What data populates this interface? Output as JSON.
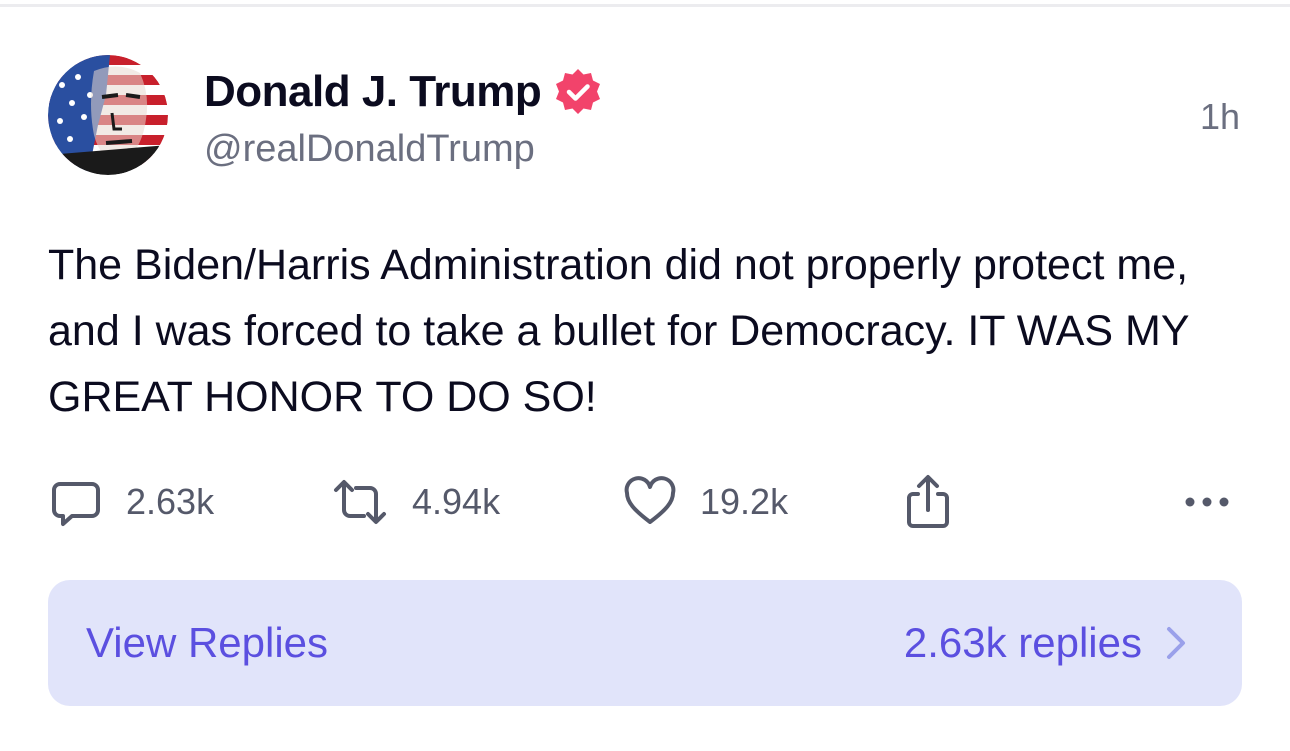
{
  "author": {
    "display_name": "Donald J. Trump",
    "handle": "@realDonaldTrump",
    "verified_icon": "verified-badge-icon",
    "verified_color": "#f2436b"
  },
  "post": {
    "timestamp": "1h",
    "text": "The Biden/Harris Administration did not properly protect me, and I was forced to take a bullet for Democracy. IT WAS MY GREAT HONOR TO DO SO!"
  },
  "actions": {
    "replies": {
      "icon": "comment-icon",
      "count": "2.63k"
    },
    "reposts": {
      "icon": "repost-icon",
      "count": "4.94k"
    },
    "likes": {
      "icon": "heart-icon",
      "count": "19.2k"
    },
    "share": {
      "icon": "share-icon"
    },
    "more": {
      "icon": "more-horizontal-icon"
    }
  },
  "replies_bar": {
    "label": "View Replies",
    "count_label": "2.63k replies",
    "background": "#e1e4fa",
    "accent": "#5b4fe0"
  }
}
